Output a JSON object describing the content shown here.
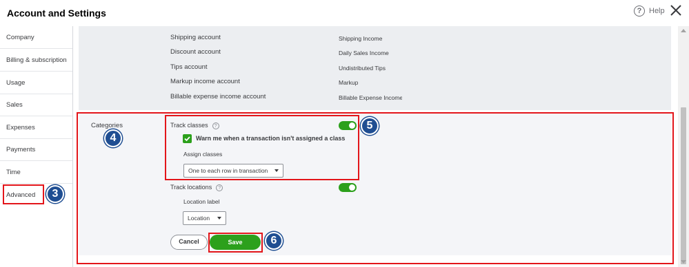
{
  "header": {
    "title": "Account and Settings",
    "help_label": "Help"
  },
  "sidebar": {
    "items": [
      {
        "label": "Company"
      },
      {
        "label": "Billing & subscription"
      },
      {
        "label": "Usage"
      },
      {
        "label": "Sales"
      },
      {
        "label": "Expenses"
      },
      {
        "label": "Payments"
      },
      {
        "label": "Time"
      },
      {
        "label": "Advanced"
      }
    ],
    "active": "Advanced"
  },
  "accounts": {
    "rows": [
      {
        "label": "Shipping account",
        "value": "Shipping Income"
      },
      {
        "label": "Discount account",
        "value": "Daily Sales Income"
      },
      {
        "label": "Tips account",
        "value": "Undistributed Tips"
      },
      {
        "label": "Markup income account",
        "value": "Markup"
      },
      {
        "label": "Billable expense income account",
        "value": "Billable Expense Income"
      }
    ]
  },
  "categories": {
    "section_label": "Categories",
    "track_classes_label": "Track classes",
    "warn_label": "Warn me when a transaction isn't assigned a class",
    "assign_classes_label": "Assign classes",
    "assign_classes_value": "One to each row in transaction",
    "track_locations_label": "Track locations",
    "location_label_label": "Location label",
    "location_label_value": "Location",
    "cancel_label": "Cancel",
    "save_label": "Save",
    "track_classes_on": true,
    "track_locations_on": true,
    "warn_checked": true
  },
  "annotations": {
    "badge_3": "3",
    "badge_4": "4",
    "badge_5": "5",
    "badge_6": "6"
  },
  "colors": {
    "toggle_on": "#2ca01c",
    "annotation_red": "#e3151a",
    "badge_blue": "#1f4e92"
  }
}
